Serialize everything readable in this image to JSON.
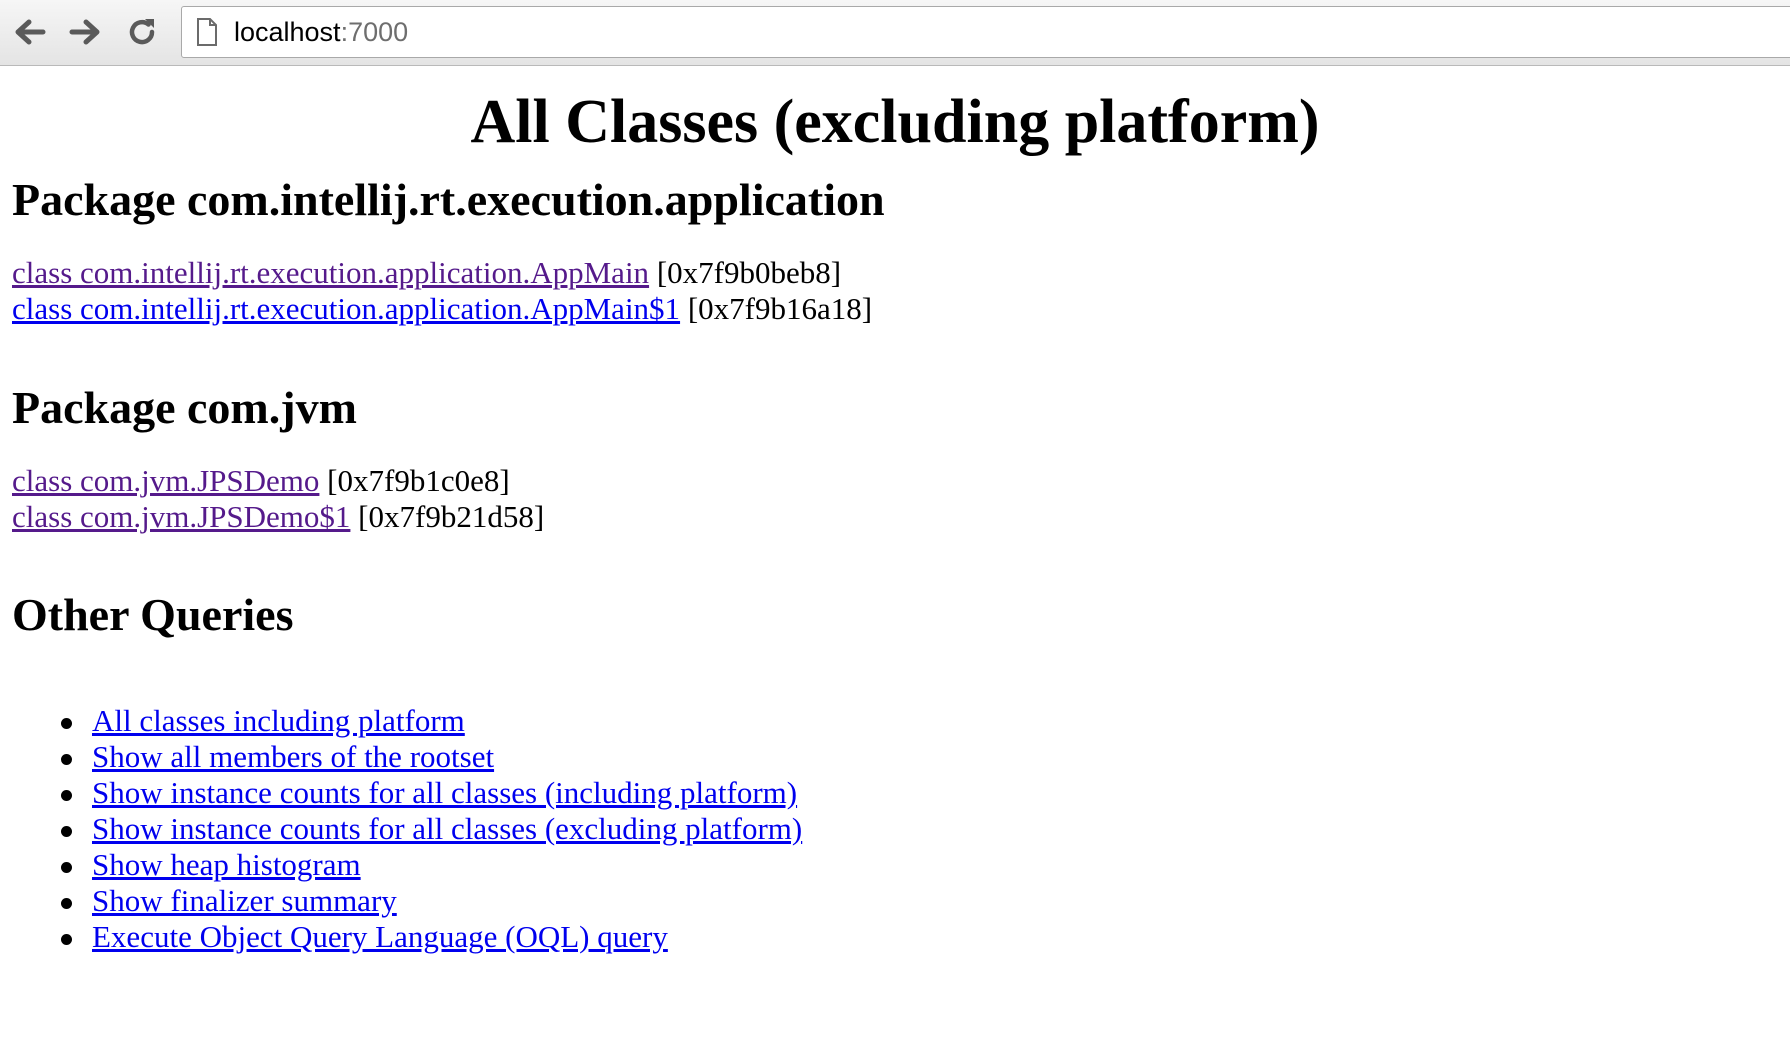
{
  "browser": {
    "url_host": "localhost",
    "url_port": ":7000",
    "icons": {
      "back": "back-arrow-icon",
      "forward": "forward-arrow-icon",
      "reload": "reload-icon",
      "page": "page-icon"
    }
  },
  "page": {
    "title": "All Classes (excluding platform)",
    "packages": [
      {
        "heading": "Package com.intellij.rt.execution.application",
        "classes": [
          {
            "link": "class com.intellij.rt.execution.application.AppMain",
            "address": "[0x7f9b0beb8]"
          },
          {
            "link": "class com.intellij.rt.execution.application.AppMain$1",
            "address": "[0x7f9b16a18]"
          }
        ]
      },
      {
        "heading": "Package com.jvm",
        "classes": [
          {
            "link": "class com.jvm.JPSDemo",
            "address": "[0x7f9b1c0e8]"
          },
          {
            "link": "class com.jvm.JPSDemo$1",
            "address": "[0x7f9b21d58]"
          }
        ]
      }
    ],
    "other_queries": {
      "heading": "Other Queries",
      "items": [
        "All classes including platform",
        "Show all members of the rootset",
        "Show instance counts for all classes (including platform)",
        "Show instance counts for all classes (excluding platform)",
        "Show heap histogram",
        "Show finalizer summary",
        "Execute Object Query Language (OQL) query"
      ]
    }
  },
  "colors": {
    "link": "#0000ee",
    "visited_link": "#551a8b"
  }
}
